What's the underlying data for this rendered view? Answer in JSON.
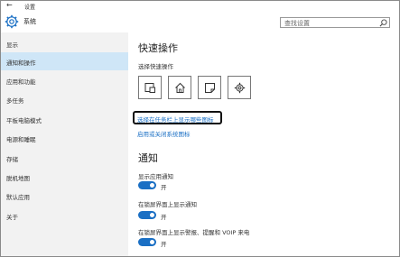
{
  "window": {
    "back": "←",
    "title": "设置"
  },
  "header": {
    "section": "系统",
    "search_placeholder": "查找设置"
  },
  "sidebar": {
    "items": [
      {
        "label": "显示"
      },
      {
        "label": "通知和操作"
      },
      {
        "label": "应用和功能"
      },
      {
        "label": "多任务"
      },
      {
        "label": "平板电脑模式"
      },
      {
        "label": "电源和睡眠"
      },
      {
        "label": "存储"
      },
      {
        "label": "脱机地图"
      },
      {
        "label": "默认应用"
      },
      {
        "label": "关于"
      }
    ],
    "active_index": 1
  },
  "main": {
    "quick_actions_title": "快速操作",
    "quick_actions_sub": "选择快速操作",
    "quick_action_icons": [
      "tablet-mode-icon",
      "home-icon",
      "note-icon",
      "settings-gear-icon"
    ],
    "link_taskbar_icons": "选择在任务栏上显示哪些图标",
    "link_system_icons": "启用或关闭系统图标",
    "notifications_title": "通知",
    "notifications": [
      {
        "label": "显示应用通知",
        "state": "开"
      },
      {
        "label": "在锁屏界面上显示通知",
        "state": "开"
      },
      {
        "label": "在锁屏界面上显示警报、提醒和 VOIP 来电",
        "state": "开"
      }
    ]
  },
  "colors": {
    "accent": "#1a6fc4",
    "sidebar_bg": "#f2f2f2",
    "active_bg": "#cfe6f7"
  }
}
